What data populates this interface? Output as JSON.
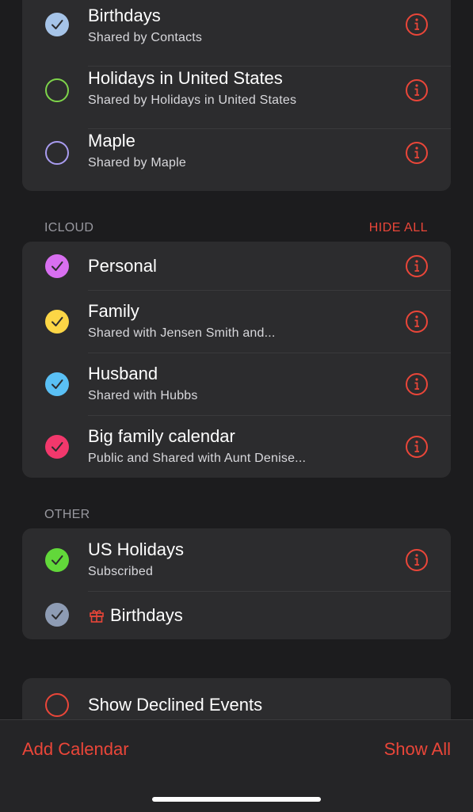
{
  "groups": {
    "shared": {
      "rows": [
        {
          "title": "Birthdays",
          "subtitle": "Shared by Contacts",
          "color": "#a6c4e8",
          "checked": true
        },
        {
          "title": "Holidays in United States",
          "subtitle": "Shared by Holidays in United States",
          "color": "#7ed44a",
          "checked": false
        },
        {
          "title": "Maple",
          "subtitle": "Shared by Maple",
          "color": "#a99cf0",
          "checked": false
        }
      ]
    },
    "icloud": {
      "header": "ICLOUD",
      "action": "HIDE ALL",
      "rows": [
        {
          "title": "Personal",
          "subtitle": "",
          "color": "#d86ff0",
          "checked": true
        },
        {
          "title": "Family",
          "subtitle": "Shared with Jensen Smith and...",
          "color": "#fcd646",
          "checked": true
        },
        {
          "title": "Husband",
          "subtitle": "Shared with Hubbs",
          "color": "#5ac0f5",
          "checked": true
        },
        {
          "title": "Big family calendar",
          "subtitle": "Public and Shared with Aunt Denise...",
          "color": "#f2386c",
          "checked": true
        }
      ]
    },
    "other": {
      "header": "OTHER",
      "rows": [
        {
          "title": "US Holidays",
          "subtitle": "Subscribed",
          "color": "#62d83a",
          "checked": true
        },
        {
          "title": "Birthdays",
          "subtitle": "",
          "color": "#8e9cb4",
          "checked": true,
          "icon": "gift-icon"
        }
      ]
    },
    "declined": {
      "rows": [
        {
          "title": "Show Declined Events",
          "color": "#ea4639",
          "checked": false
        }
      ]
    }
  },
  "toolbar": {
    "add_calendar": "Add Calendar",
    "show_all": "Show All"
  },
  "colors": {
    "accent": "#ea4639",
    "background": "#1c1c1e",
    "cell": "#2c2c2e"
  },
  "icons": {
    "info": "info-icon",
    "check": "checkmark-icon",
    "gift": "gift-icon"
  }
}
